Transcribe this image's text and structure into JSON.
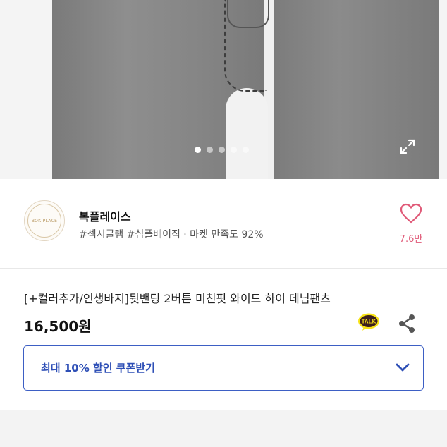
{
  "gallery": {
    "total_dots": 5,
    "active_index": 0
  },
  "seller": {
    "logo_text": "BOK PLACE",
    "name": "복플레이스",
    "tags": "#섹시글램 #심플베이직 · 마켓 만족도 92%",
    "likes": "7.6만"
  },
  "product": {
    "title": "[+컬러추가/인생바지]뒷밴딩 2버튼 미친핏 와이드 하이 데님팬츠",
    "price": "16,500원",
    "talk_label": "TALK"
  },
  "coupon": {
    "label": "최대 10% 할인 쿠폰받기"
  },
  "colors": {
    "accent_blue": "#2e4fb6",
    "heart_pink": "#e05a78",
    "talk_yellow": "#f7e317"
  },
  "icons": {
    "expand": "expand-icon",
    "heart": "heart-icon",
    "share": "share-icon",
    "chevron": "chevron-down-icon"
  }
}
